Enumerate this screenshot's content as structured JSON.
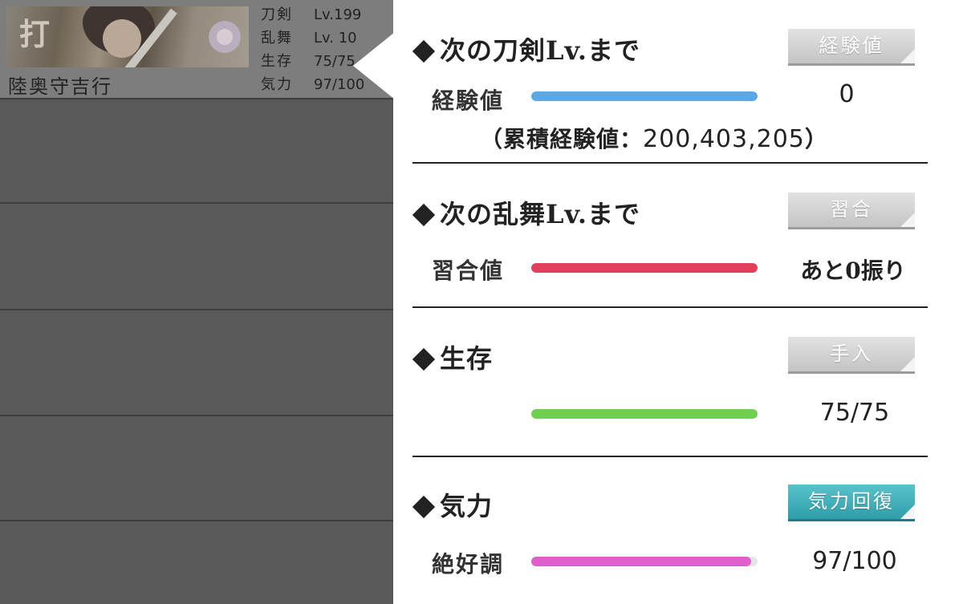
{
  "unit": {
    "kind_glyph": "打",
    "name": "陸奥守吉行",
    "stats": [
      {
        "key": "刀剣",
        "value": "Lv.199"
      },
      {
        "key": "乱舞",
        "value": "Lv. 10"
      },
      {
        "key": "生存",
        "value": "75/75"
      },
      {
        "key": "気力",
        "value": "97/100"
      }
    ]
  },
  "popup": {
    "sword_level": {
      "title": "次の刀剣Lv.まで",
      "button": "経験値",
      "row_label": "経験値",
      "value": "0",
      "progress": 1.0,
      "bar_color": "#5aa9e6",
      "cumulative_prefix": "（累積経験値：",
      "cumulative_value": "200,403,205",
      "cumulative_suffix": "）"
    },
    "ranbu_level": {
      "title": "次の乱舞Lv.まで",
      "button": "習合",
      "row_label": "習合値",
      "value": "あと0振り",
      "progress": 1.0,
      "bar_color": "#e0405c"
    },
    "survival": {
      "title": "生存",
      "button": "手入",
      "value": "75/75",
      "progress": 1.0,
      "bar_color": "#6fd04f"
    },
    "fatigue": {
      "title": "気力",
      "button": "気力回復",
      "row_label": "絶好調",
      "value": "97/100",
      "progress": 0.97,
      "bar_color": "#e05fcc"
    }
  }
}
